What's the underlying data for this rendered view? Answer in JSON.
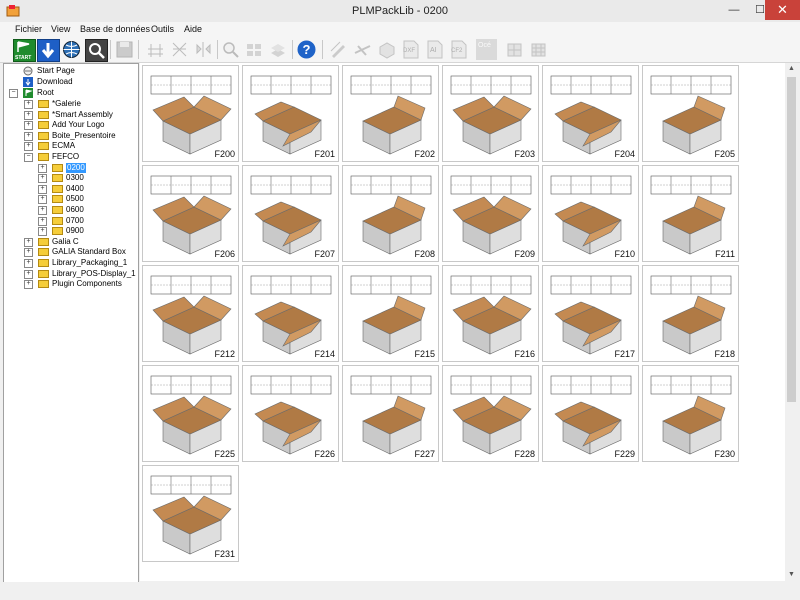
{
  "window": {
    "title": "PLMPackLib - 0200"
  },
  "menu": [
    "Fichier",
    "View",
    "Base de données",
    "Outils",
    "Aide"
  ],
  "toolbar": {
    "start_label": "START",
    "dxf_label": "DXF",
    "ai_label": "AI",
    "cf2_label": "CF2",
    "oce_label": "Océ"
  },
  "tree": {
    "start_page": "Start Page",
    "download": "Download",
    "root": "Root",
    "items": [
      "*Galerie",
      "*Smart Assembly",
      "Add Your Logo",
      "Boite_Presentoire",
      "ECMA",
      "FEFCO"
    ],
    "fefco_children": [
      "0200",
      "0300",
      "0400",
      "0500",
      "0600",
      "0700",
      "0900"
    ],
    "items_after": [
      "Galia C",
      "GALIA Standard Box",
      "Library_Packaging_1",
      "Library_POS-Display_1",
      "Plugin Components"
    ]
  },
  "grid": {
    "tiles": [
      "F200",
      "F201",
      "F202",
      "F203",
      "F204",
      "F205",
      "F206",
      "F207",
      "F208",
      "F209",
      "F210",
      "F211",
      "F212",
      "F214",
      "F215",
      "F216",
      "F217",
      "F218",
      "F225",
      "F226",
      "F227",
      "F228",
      "F229",
      "F230",
      "F231"
    ]
  }
}
